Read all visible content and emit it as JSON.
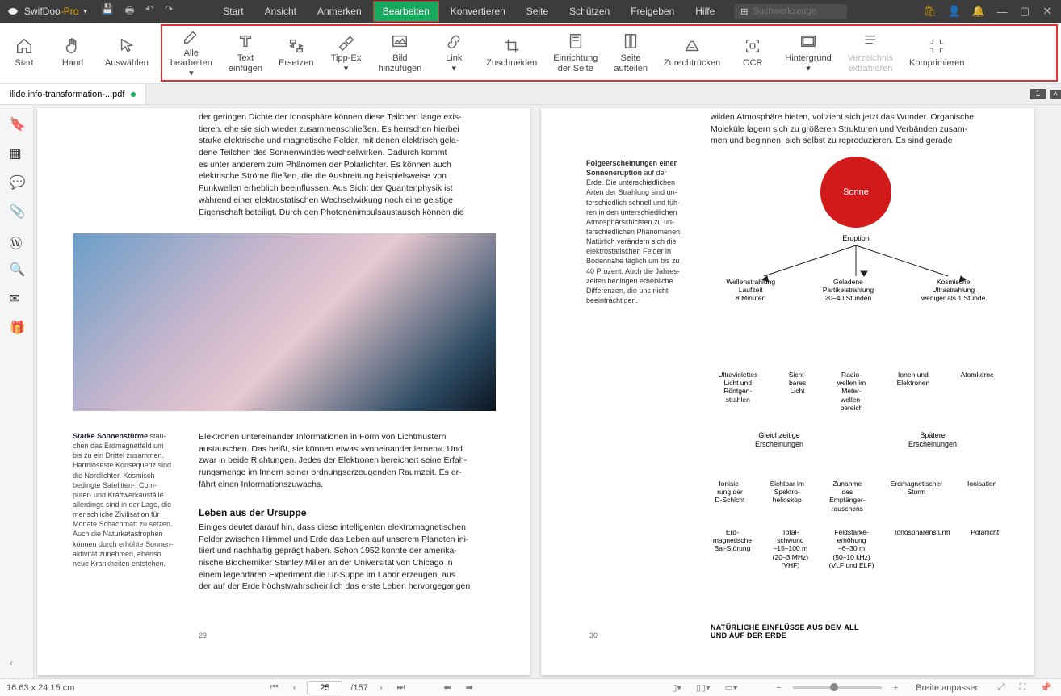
{
  "app": {
    "name1": "SwifDoo",
    "name2": "-Pro"
  },
  "menu": [
    "Start",
    "Ansicht",
    "Anmerken",
    "Bearbeiten",
    "Konvertieren",
    "Seite",
    "Schützen",
    "Freigeben",
    "Hilfe"
  ],
  "menu_active": 3,
  "search_placeholder": "Suchwerkzeuge",
  "tools_left": [
    {
      "label": "Start",
      "icon": "home"
    },
    {
      "label": "Hand",
      "icon": "hand"
    },
    {
      "label": "Auswählen",
      "icon": "cursor"
    }
  ],
  "tools_red": [
    {
      "label": "Alle\nbearbeiten",
      "icon": "edit",
      "caret": true
    },
    {
      "label": "Text\neinfügen",
      "icon": "text"
    },
    {
      "label": "Ersetzen",
      "icon": "replace"
    },
    {
      "label": "Tipp-Ex",
      "icon": "tippex",
      "caret": true
    },
    {
      "label": "Bild\nhinzufügen",
      "icon": "image"
    },
    {
      "label": "Link",
      "icon": "link",
      "caret": true
    },
    {
      "label": "Zuschneiden",
      "icon": "crop"
    },
    {
      "label": "Einrichtung\nder Seite",
      "icon": "pagesetup"
    },
    {
      "label": "Seite\naufteilen",
      "icon": "split"
    },
    {
      "label": "Zurechtrücken",
      "icon": "deskew"
    },
    {
      "label": "OCR",
      "icon": "ocr"
    },
    {
      "label": "Hintergrund",
      "icon": "bg",
      "caret": true
    },
    {
      "label": "Verzeichnis\nextrahieren",
      "icon": "toc",
      "disabled": true
    },
    {
      "label": "Komprimieren",
      "icon": "compress"
    }
  ],
  "doc_tab": "ilide.info-transformation-...pdf",
  "page_indicator": "1",
  "sidebar_icons": [
    "bookmark",
    "thumbs",
    "comments",
    "attach",
    "word",
    "search",
    "mail",
    "gift"
  ],
  "page1": {
    "para1": "der geringen Dichte der Ionosphäre können diese Teilchen lange exis-\ntieren, ehe sie sich wieder zusammenschließen. Es herrschen hierbei\nstarke elektrische und magnetische Felder, mit denen elektrisch gela-\ndene Teilchen des Sonnenwindes wechselwirken. Dadurch kommt\nes unter anderem zum Phänomen der Polarlichter. Es können auch\nelektrische Ströme fließen, die die Ausbreitung beispielsweise von\nFunkwellen erheblich beeinflussen. Aus Sicht der Quantenphysik ist\nwährend einer elektrostatischen Wechselwirkung noch eine geistige\nEigenschaft beteiligt. Durch den Photonenimpulsaustausch können die",
    "side_head": "Starke Sonnenstürme",
    "side_body": " stau-\nchen das Erdmagnetfeld um\nbis zu ein Drittel zusammen.\nHarmloseste Konsequenz sind\ndie Nordlichter. Kosmisch\nbedingte Satelliten-, Com-\nputer- und Kraftwerkausfälle\nallerdings sind in der Lage, die\nmenschliche Zivilisation für\nMonate Schachmatt zu setzen.\nAuch die Naturkatastrophen\nkönnen durch erhöhte Sonnen-\naktivität zunehmen, ebenso\nneue Krankheiten entstehen.",
    "para2": "Elektronen untereinander Informationen in Form von Lichtmustern\naustauschen. Das heißt, sie können etwas »voneinander lernen«. Und\nzwar in beide Richtungen. Jedes der Elektronen bereichert seine Erfah-\nrungsmenge im Innern seiner ordnungserzeugenden Raumzeit. Es er-\nfährt einen Informationszuwachs.",
    "h2": "Leben aus der Ursuppe",
    "para3": "Einiges deutet darauf hin, dass diese intelligenten elektromagnetischen\nFelder zwischen Himmel und Erde das Leben auf unserem Planeten ini-\ntiiert und nachhaltig geprägt haben. Schon 1952 konnte der amerika-\nnische Biochemiker Stanley Miller an der Universität von Chicago in\neinem legendären Experiment die Ur-Suppe im Labor erzeugen, aus\nder auf der Erde höchstwahrscheinlich das erste Leben hervorgegangen",
    "num": "29"
  },
  "page2": {
    "top": "wilden Atmosphäre bieten, vollzieht sich jetzt das Wunder. Organische\nMoleküle lagern sich zu größeren Strukturen und Verbänden zusam-\nmen und beginnen, sich selbst zu reproduzieren. Es sind gerade",
    "side_head": "Folgeerscheinungen einer Sonneneruption",
    "side_body": " auf der\nErde. Die unterschiedlichen\nArten der Strahlung sind un-\nterschiedlich schnell und füh-\nren in den unterschiedlichen\nAtmosphärschichten zu un-\nterschiedlichen Phänomenen.\nNatürlich verändern sich die\nelektrostatischen Felder in\nBodennähe täglich um bis zu\n40 Prozent. Auch die Jahres-\nzeiten bedingen erhebliche\nDifferenzen, die uns nicht\nbeeinträchtigen.",
    "sun": "Sonne",
    "eruption": "Eruption",
    "row1": [
      "Wellenstrahlung\nLaufzeit\n8 Minuten",
      "Geladene\nPartikelstrahlung\n20–40 Stunden",
      "Kosmische Ultrastrahlung\nweniger als 1 Stunde"
    ],
    "row2": [
      "Ultraviolettes\nLicht und\nRöntgen-\nstrahlen",
      "Sicht-\nbares\nLicht",
      "Radio-\nwellen im\nMeter-\nwellen-\nbereich",
      "Ionen und\nElektronen",
      "Atomkerne"
    ],
    "row3": [
      "Gleichzeitige Erscheinungen",
      "Spätere Erscheinungen"
    ],
    "row35": [
      "Ionisie-\nrung der\nD-Schicht",
      "Sichtbar im\nSpektro-\nhelioskop",
      "Zunahme\ndes\nEmpfänger-\nrauschens",
      "Erdmagnetischer\nSturm",
      "Ionisation"
    ],
    "row4": [
      "Erd-\nmagnetische\nBai-Störung",
      "Total-\nschwund\n–15–100 m\n(20–3 MHz)\n(VHF)",
      "Feldstärke-\nerhöhung\n–6–30 m\n(50–10 kHz)\n(VLF und ELF)",
      "Ionosphärensturm",
      "Polarlicht"
    ],
    "footer": "NATÜRLICHE EINFLÜSSE AUS DEM ALL\nUND AUF DER ERDE",
    "num": "30"
  },
  "status": {
    "dims": "16.63 x 24.15 cm",
    "page": "25",
    "total": "/157",
    "fit": "Breite anpassen"
  }
}
